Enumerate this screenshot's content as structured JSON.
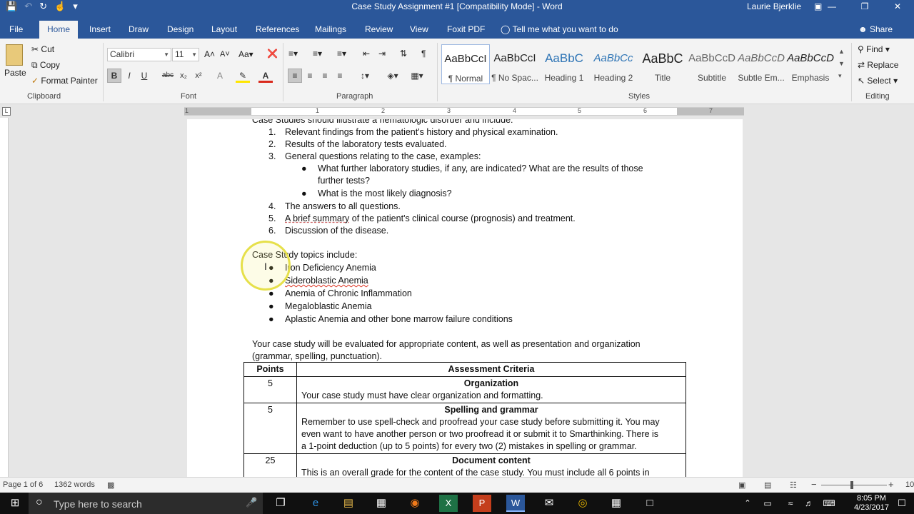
{
  "window": {
    "title": "Case Study Assignment #1 [Compatibility Mode]  -  Word",
    "user": "Laurie Bjerklie",
    "controls": [
      "minimize-icon",
      "restore-icon",
      "close-icon"
    ]
  },
  "qat": {
    "icons": [
      "save-icon",
      "undo-icon",
      "redo-icon",
      "touch-mode-icon",
      "customize-icon"
    ]
  },
  "tabs": [
    "File",
    "Home",
    "Insert",
    "Draw",
    "Design",
    "Layout",
    "References",
    "Mailings",
    "Review",
    "View",
    "Foxit PDF"
  ],
  "tell_me": "Tell me what you want to do",
  "share": "Share",
  "clipboard": {
    "paste": "Paste",
    "cut": "Cut",
    "copy": "Copy",
    "format_painter": "Format Painter",
    "label": "Clipboard"
  },
  "font": {
    "name": "Calibri",
    "size": "11",
    "label": "Font",
    "bold": "B",
    "italic": "I",
    "underline": "U",
    "strike": "abc",
    "sub": "x₂",
    "sup": "x²"
  },
  "paragraph": {
    "label": "Paragraph"
  },
  "styles": {
    "label": "Styles",
    "items": [
      {
        "preview": "AaBbCcI",
        "name": "¶ Normal"
      },
      {
        "preview": "AaBbCcI",
        "name": "¶ No Spac..."
      },
      {
        "preview": "AaBbC",
        "name": "Heading 1"
      },
      {
        "preview": "AaBbCc",
        "name": "Heading 2"
      },
      {
        "preview": "AaBbC",
        "name": "Title"
      },
      {
        "preview": "AaBbCcD",
        "name": "Subtitle"
      },
      {
        "preview": "AaBbCcD",
        "name": "Subtle Em..."
      },
      {
        "preview": "AaBbCcD",
        "name": "Emphasis"
      }
    ]
  },
  "editing": {
    "find": "Find",
    "replace": "Replace",
    "select": "Select",
    "label": "Editing"
  },
  "ruler_numbers": [
    "1",
    "1",
    "2",
    "3",
    "4",
    "5",
    "6",
    "7"
  ],
  "document": {
    "intro": "Case Studies should illustrate a hematologic disorder and include:",
    "items": [
      {
        "n": "1.",
        "text": "Relevant findings from the patient's history and physical examination."
      },
      {
        "n": "2.",
        "text": "Results of the laboratory tests evaluated."
      },
      {
        "n": "3.",
        "text": "General questions relating to the case, examples:"
      }
    ],
    "sub_items": [
      "What further laboratory studies, if any, are indicated? What are the results of those",
      "further tests?",
      "What is the most likely diagnosis?"
    ],
    "items2": [
      {
        "n": "4.",
        "text": "The answers to all questions."
      },
      {
        "n": "5.",
        "text_a": "A brief summary",
        "text_b": " of the patient's clinical course (prognosis) and treatment."
      },
      {
        "n": "6.",
        "text": "Discussion of the disease."
      }
    ],
    "topics_heading": "Case Study topics include:",
    "topics": [
      "Iron Deficiency Anemia",
      "Sideroblastic Anemia",
      "Anemia of Chronic Inflammation",
      "Megaloblastic Anemia",
      "Aplastic Anemia and other bone marrow failure conditions"
    ],
    "eval_line1": "Your case study will be evaluated for appropriate content, as well as presentation and organization",
    "eval_line2": "(grammar, spelling, punctuation).",
    "table": {
      "headers": [
        "Points",
        "Assessment Criteria"
      ],
      "rows": [
        {
          "points": "5",
          "title": "Organization",
          "lines": [
            "Your case study must have clear organization and formatting."
          ]
        },
        {
          "points": "5",
          "title": "Spelling and grammar",
          "lines": [
            "Remember to use spell-check and proofread your case study before submitting it. You may",
            "even want to have another person or two proofread it or submit it to Smarthinking.  There is",
            "a 1-point deduction (up to 5 points) for every two (2) mistakes in spelling or grammar."
          ]
        },
        {
          "points": "25",
          "title": "Document content",
          "lines": [
            "This is an overall grade for the content of the case study.  You must include all 6 points in"
          ]
        }
      ]
    }
  },
  "status": {
    "page": "Page 1 of 6",
    "words": "1362 words",
    "zoom": "10"
  },
  "taskbar": {
    "search_placeholder": "Type here to search",
    "time": "8:05 PM",
    "date": "4/23/2017"
  }
}
